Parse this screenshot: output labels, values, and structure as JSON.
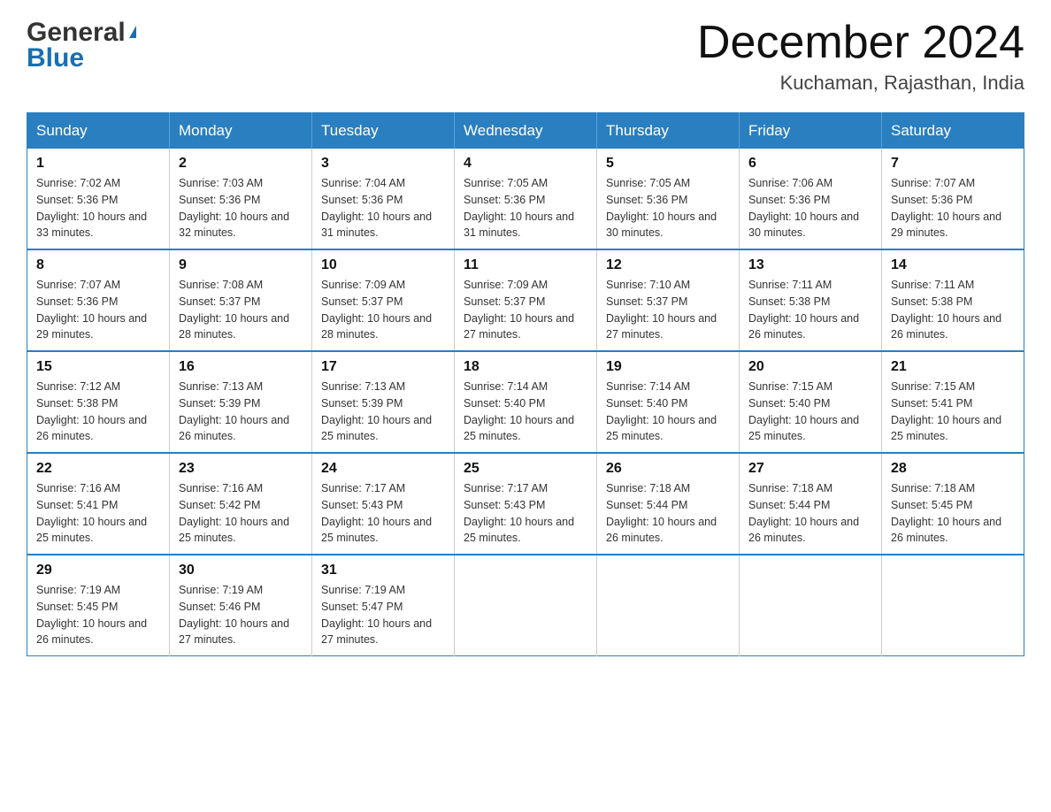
{
  "header": {
    "logo_general": "General",
    "logo_arrow": "▶",
    "logo_blue": "Blue",
    "month_title": "December 2024",
    "location": "Kuchaman, Rajasthan, India"
  },
  "days_of_week": [
    "Sunday",
    "Monday",
    "Tuesday",
    "Wednesday",
    "Thursday",
    "Friday",
    "Saturday"
  ],
  "weeks": [
    [
      {
        "day": "1",
        "sunrise": "7:02 AM",
        "sunset": "5:36 PM",
        "daylight": "10 hours and 33 minutes."
      },
      {
        "day": "2",
        "sunrise": "7:03 AM",
        "sunset": "5:36 PM",
        "daylight": "10 hours and 32 minutes."
      },
      {
        "day": "3",
        "sunrise": "7:04 AM",
        "sunset": "5:36 PM",
        "daylight": "10 hours and 31 minutes."
      },
      {
        "day": "4",
        "sunrise": "7:05 AM",
        "sunset": "5:36 PM",
        "daylight": "10 hours and 31 minutes."
      },
      {
        "day": "5",
        "sunrise": "7:05 AM",
        "sunset": "5:36 PM",
        "daylight": "10 hours and 30 minutes."
      },
      {
        "day": "6",
        "sunrise": "7:06 AM",
        "sunset": "5:36 PM",
        "daylight": "10 hours and 30 minutes."
      },
      {
        "day": "7",
        "sunrise": "7:07 AM",
        "sunset": "5:36 PM",
        "daylight": "10 hours and 29 minutes."
      }
    ],
    [
      {
        "day": "8",
        "sunrise": "7:07 AM",
        "sunset": "5:36 PM",
        "daylight": "10 hours and 29 minutes."
      },
      {
        "day": "9",
        "sunrise": "7:08 AM",
        "sunset": "5:37 PM",
        "daylight": "10 hours and 28 minutes."
      },
      {
        "day": "10",
        "sunrise": "7:09 AM",
        "sunset": "5:37 PM",
        "daylight": "10 hours and 28 minutes."
      },
      {
        "day": "11",
        "sunrise": "7:09 AM",
        "sunset": "5:37 PM",
        "daylight": "10 hours and 27 minutes."
      },
      {
        "day": "12",
        "sunrise": "7:10 AM",
        "sunset": "5:37 PM",
        "daylight": "10 hours and 27 minutes."
      },
      {
        "day": "13",
        "sunrise": "7:11 AM",
        "sunset": "5:38 PM",
        "daylight": "10 hours and 26 minutes."
      },
      {
        "day": "14",
        "sunrise": "7:11 AM",
        "sunset": "5:38 PM",
        "daylight": "10 hours and 26 minutes."
      }
    ],
    [
      {
        "day": "15",
        "sunrise": "7:12 AM",
        "sunset": "5:38 PM",
        "daylight": "10 hours and 26 minutes."
      },
      {
        "day": "16",
        "sunrise": "7:13 AM",
        "sunset": "5:39 PM",
        "daylight": "10 hours and 26 minutes."
      },
      {
        "day": "17",
        "sunrise": "7:13 AM",
        "sunset": "5:39 PM",
        "daylight": "10 hours and 25 minutes."
      },
      {
        "day": "18",
        "sunrise": "7:14 AM",
        "sunset": "5:40 PM",
        "daylight": "10 hours and 25 minutes."
      },
      {
        "day": "19",
        "sunrise": "7:14 AM",
        "sunset": "5:40 PM",
        "daylight": "10 hours and 25 minutes."
      },
      {
        "day": "20",
        "sunrise": "7:15 AM",
        "sunset": "5:40 PM",
        "daylight": "10 hours and 25 minutes."
      },
      {
        "day": "21",
        "sunrise": "7:15 AM",
        "sunset": "5:41 PM",
        "daylight": "10 hours and 25 minutes."
      }
    ],
    [
      {
        "day": "22",
        "sunrise": "7:16 AM",
        "sunset": "5:41 PM",
        "daylight": "10 hours and 25 minutes."
      },
      {
        "day": "23",
        "sunrise": "7:16 AM",
        "sunset": "5:42 PM",
        "daylight": "10 hours and 25 minutes."
      },
      {
        "day": "24",
        "sunrise": "7:17 AM",
        "sunset": "5:43 PM",
        "daylight": "10 hours and 25 minutes."
      },
      {
        "day": "25",
        "sunrise": "7:17 AM",
        "sunset": "5:43 PM",
        "daylight": "10 hours and 25 minutes."
      },
      {
        "day": "26",
        "sunrise": "7:18 AM",
        "sunset": "5:44 PM",
        "daylight": "10 hours and 26 minutes."
      },
      {
        "day": "27",
        "sunrise": "7:18 AM",
        "sunset": "5:44 PM",
        "daylight": "10 hours and 26 minutes."
      },
      {
        "day": "28",
        "sunrise": "7:18 AM",
        "sunset": "5:45 PM",
        "daylight": "10 hours and 26 minutes."
      }
    ],
    [
      {
        "day": "29",
        "sunrise": "7:19 AM",
        "sunset": "5:45 PM",
        "daylight": "10 hours and 26 minutes."
      },
      {
        "day": "30",
        "sunrise": "7:19 AM",
        "sunset": "5:46 PM",
        "daylight": "10 hours and 27 minutes."
      },
      {
        "day": "31",
        "sunrise": "7:19 AM",
        "sunset": "5:47 PM",
        "daylight": "10 hours and 27 minutes."
      },
      null,
      null,
      null,
      null
    ]
  ],
  "labels": {
    "sunrise_prefix": "Sunrise: ",
    "sunset_prefix": "Sunset: ",
    "daylight_prefix": "Daylight: "
  }
}
